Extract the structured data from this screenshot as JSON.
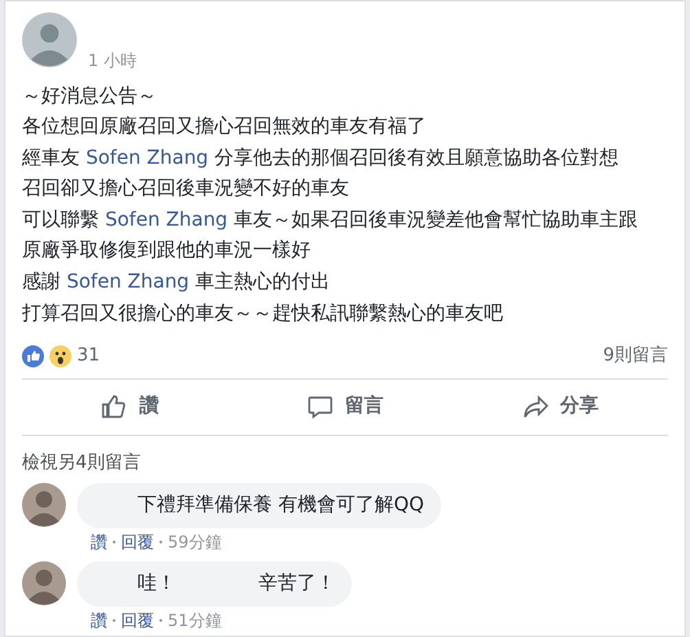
{
  "post": {
    "time": "1 小時",
    "paragraphs": [
      [
        [
          {
            "text": "～好消息公告～"
          }
        ],
        [
          {
            "text": "各位想回原廠召回又擔心召回無效的車友有福了"
          }
        ]
      ],
      [
        [
          {
            "text": "經車友 "
          },
          {
            "text": "Sofen Zhang",
            "kind": "mention"
          },
          {
            "text": " 分享他去的那個召回後有效且願意協助各位對想"
          }
        ],
        [
          {
            "text": "召回卻又擔心召回後車況變不好的車友"
          }
        ]
      ],
      [
        [
          {
            "text": "可以聯繫 "
          },
          {
            "text": "Sofen Zhang",
            "kind": "mention"
          },
          {
            "text": " 車友～如果召回後車況變差他會幫忙協助車主跟"
          }
        ],
        [
          {
            "text": "原廠爭取修復到跟他的車況一樣好"
          }
        ]
      ],
      [
        [
          {
            "text": "感謝 "
          },
          {
            "text": "Sofen Zhang",
            "kind": "mention"
          },
          {
            "text": " 車主熱心的付出"
          }
        ]
      ],
      [
        [
          {
            "text": "打算召回又很擔心的車友～～趕快私訊聯繫熱心的車友吧"
          }
        ]
      ]
    ],
    "reaction_count": "31",
    "comment_count": "9則留言",
    "actions": [
      "讚",
      "留言",
      "分享"
    ]
  },
  "comments": {
    "more_link": "檢視另4則留言",
    "items": [
      {
        "parts": [
          "下禮拜準備保養 有機會可了解QQ"
        ],
        "like": "讚",
        "reply": "回覆",
        "time": "59分鐘"
      },
      {
        "parts": [
          "哇！",
          "辛苦了！"
        ],
        "like": "讚",
        "reply": "回覆",
        "time": "51分鐘"
      }
    ]
  }
}
